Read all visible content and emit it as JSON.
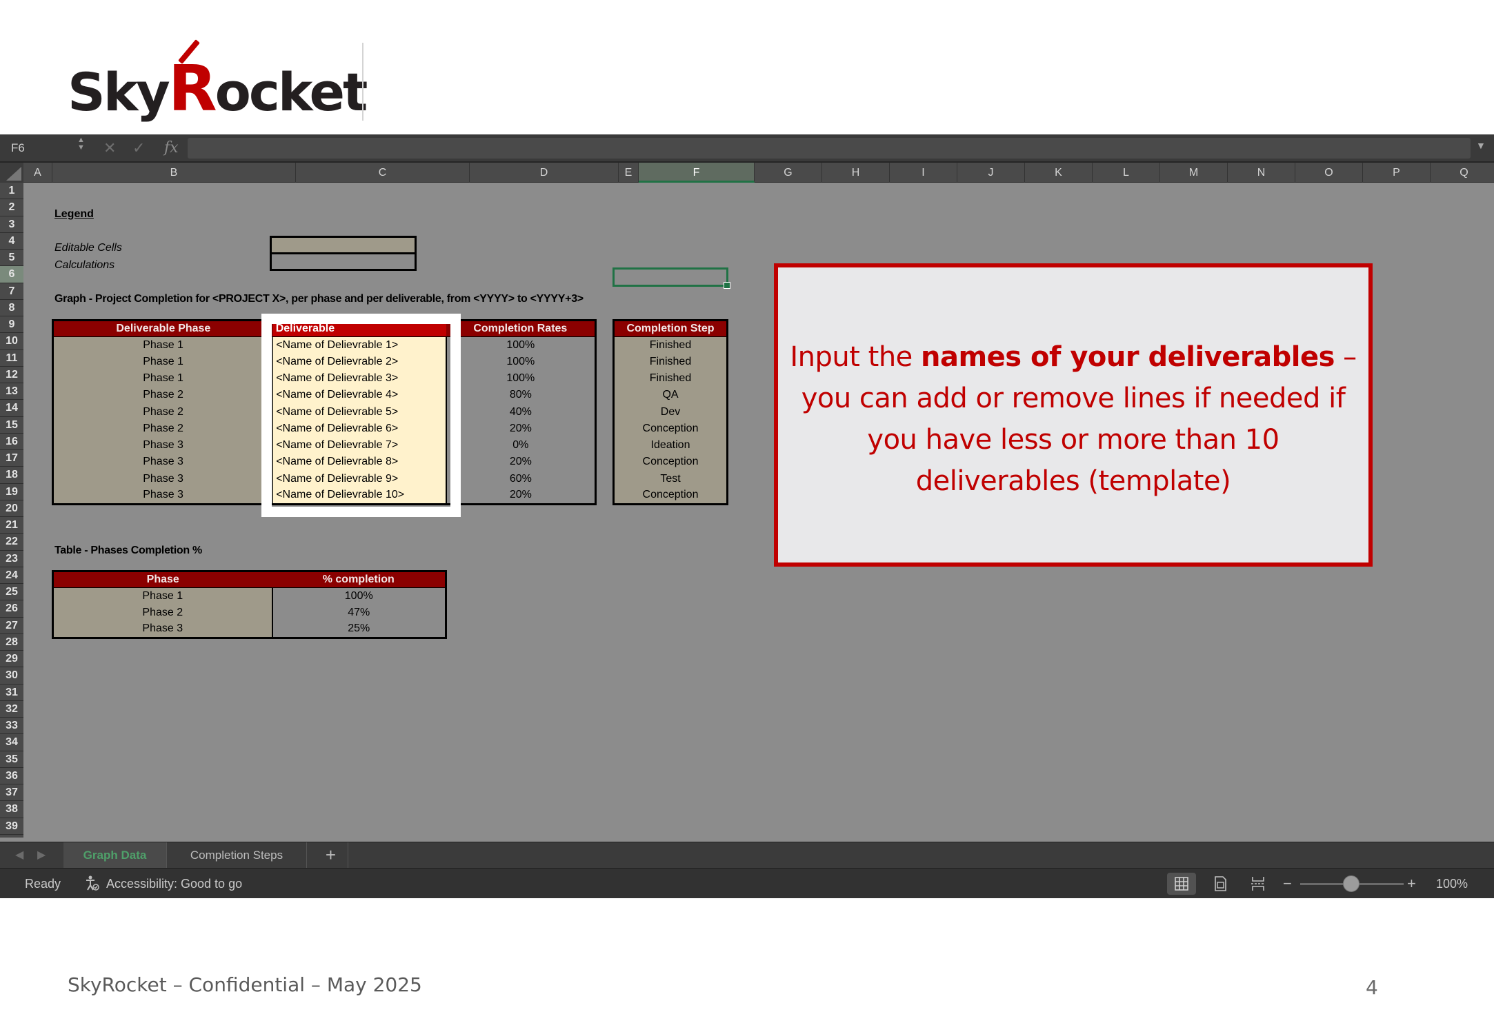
{
  "logo": {
    "text_before": "Sky",
    "text_r": "R",
    "text_after": "ocket"
  },
  "excel": {
    "name_box": "F6",
    "columns": [
      "A",
      "B",
      "C",
      "D",
      "E",
      "F",
      "G",
      "H",
      "I",
      "J",
      "K",
      "L",
      "M",
      "N",
      "O",
      "P",
      "Q"
    ],
    "legend": {
      "title": "Legend",
      "editable_label": "Editable Cells",
      "calculations_label": "Calculations"
    },
    "graph_title": "Graph - Project Completion for <PROJECT X>, per phase and per deliverable, from <YYYY> to <YYYY+3>",
    "main_table": {
      "headers": [
        "Deliverable Phase",
        "Deliverable",
        "Completion Rates"
      ],
      "rows": [
        [
          "Phase 1",
          "<Name of Delievrable 1>",
          "100%"
        ],
        [
          "Phase 1",
          "<Name of Delievrable 2>",
          "100%"
        ],
        [
          "Phase 1",
          "<Name of Delievrable 3>",
          "100%"
        ],
        [
          "Phase 2",
          "<Name of Delievrable 4>",
          "80%"
        ],
        [
          "Phase 2",
          "<Name of Delievrable 5>",
          "40%"
        ],
        [
          "Phase 2",
          "<Name of Delievrable 6>",
          "20%"
        ],
        [
          "Phase 3",
          "<Name of Delievrable 7>",
          "0%"
        ],
        [
          "Phase 3",
          "<Name of Delievrable 8>",
          "20%"
        ],
        [
          "Phase 3",
          "<Name of Delievrable 9>",
          "60%"
        ],
        [
          "Phase 3",
          "<Name of Delievrable 10>",
          "20%"
        ]
      ]
    },
    "step_table": {
      "header": "Completion Step",
      "rows": [
        "Finished",
        "Finished",
        "Finished",
        "QA",
        "Dev",
        "Conception",
        "Ideation",
        "Conception",
        "Test",
        "Conception"
      ]
    },
    "phase_table_title": "Table - Phases Completion %",
    "phase_table": {
      "headers": [
        "Phase",
        "% completion"
      ],
      "rows": [
        [
          "Phase 1",
          "100%"
        ],
        [
          "Phase 2",
          "47%"
        ],
        [
          "Phase 3",
          "25%"
        ]
      ]
    },
    "sheet_tabs": [
      "Graph Data",
      "Completion Steps"
    ],
    "active_tab": "Graph Data",
    "status": {
      "ready": "Ready",
      "accessibility": "Accessibility: Good to go",
      "zoom": "100%"
    }
  },
  "callout": {
    "part1": "Input the ",
    "bold": "names of your deliverables",
    "part2": " – you can add or remove lines if needed if you have less or more than 10 deliverables (template)"
  },
  "footer": {
    "text": "SkyRocket – Confidential – May 2025",
    "page_number": "4"
  },
  "colors": {
    "accent_red": "#c00000",
    "header_dark_red": "#8b0000",
    "editable_fill": "#9f9a8a",
    "deliverable_fill": "#fff2cc",
    "excel_green": "#207245"
  }
}
